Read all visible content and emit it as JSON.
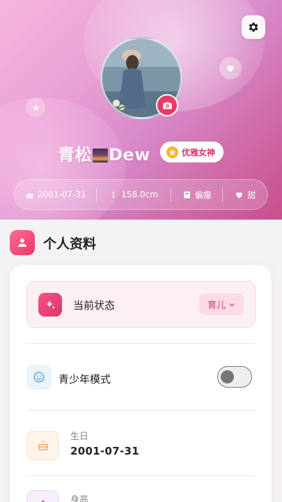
{
  "profile": {
    "nickname_prefix": "青松",
    "nickname_suffix": "Dew",
    "title_badge": "优雅女神"
  },
  "stats": {
    "birthday": "2001-07-31",
    "height": "158.0cm",
    "body_type": "偏瘦",
    "style": "甜"
  },
  "section": {
    "title": "个人资料"
  },
  "status": {
    "label": "当前状态",
    "value": "育儿"
  },
  "teen_mode": {
    "label": "青少年模式",
    "enabled": false
  },
  "birthday_field": {
    "label": "生日",
    "value": "2001-07-31"
  },
  "height_field": {
    "label": "身高"
  },
  "colors": {
    "accent": "#e8356b",
    "hero_start": "#f6b7dc",
    "hero_end": "#c84f8c"
  },
  "icons": {
    "settings": "gear-icon",
    "camera": "camera-icon",
    "heart": "heart-icon",
    "star": "star-icon",
    "cake": "cake-icon",
    "height": "height-icon",
    "body": "body-icon",
    "sparkle": "sparkle-icon",
    "smile": "smile-icon",
    "user": "user-icon"
  }
}
